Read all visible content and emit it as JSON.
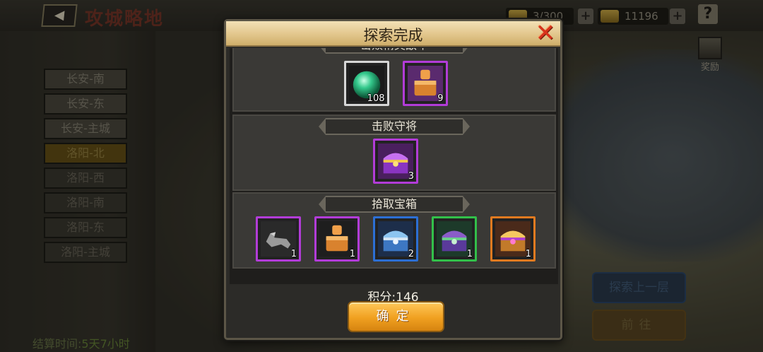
{
  "topbar": {
    "back_icon": "back-arrow-icon",
    "game_title": "攻城略地",
    "stamina": "3/300",
    "gold": "11196",
    "help_label": "?",
    "reward_label": "奖励"
  },
  "cities": [
    {
      "name": "长安-南",
      "state": "done"
    },
    {
      "name": "长安-东",
      "state": "done"
    },
    {
      "name": "长安-主城",
      "state": "done"
    },
    {
      "name": "洛阳-北",
      "state": "current"
    },
    {
      "name": "洛阳-西",
      "state": "locked"
    },
    {
      "name": "洛阳-南",
      "state": "locked"
    },
    {
      "name": "洛阳-东",
      "state": "locked"
    },
    {
      "name": "洛阳-主城",
      "state": "locked"
    }
  ],
  "settle": {
    "label": "结算时间:",
    "value": "5天7小时"
  },
  "side_buttons": {
    "explore_up": "探索上一层",
    "next": "前往"
  },
  "modal": {
    "title": "探索完成",
    "close_icon": "close-x-icon",
    "sections": [
      {
        "header": "击败精英敌军",
        "items": [
          {
            "icon": "green-orb-icon",
            "quality": "white",
            "count": "108"
          },
          {
            "icon": "bronze-seal-icon",
            "quality": "purple",
            "count": "9"
          }
        ]
      },
      {
        "header": "击败守将",
        "items": [
          {
            "icon": "purple-chest-icon",
            "quality": "purple",
            "count": "3"
          }
        ]
      },
      {
        "header": "拾取宝箱",
        "items": [
          {
            "icon": "iron-horse-icon",
            "quality": "purple",
            "count": "1"
          },
          {
            "icon": "bronze-seal-icon",
            "quality": "purple",
            "count": "1"
          },
          {
            "icon": "blue-chest-icon",
            "quality": "blue",
            "count": "2"
          },
          {
            "icon": "green-chest-icon",
            "quality": "green",
            "count": "1"
          },
          {
            "icon": "gold-chest-icon",
            "quality": "orange",
            "count": "1"
          }
        ]
      }
    ],
    "score_label": "积分:146",
    "confirm_label": "确定"
  },
  "colors": {
    "accent_gold": "#f0a020",
    "quality_white": "#d6d6d6",
    "quality_purple": "#b23cd8",
    "quality_blue": "#2c6fd4",
    "quality_green": "#32c04a",
    "quality_orange": "#e07a20"
  }
}
